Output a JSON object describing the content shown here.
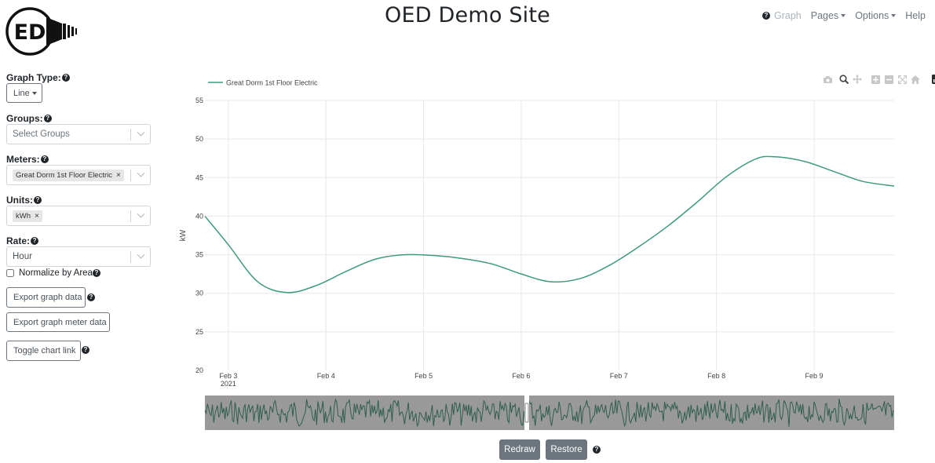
{
  "header": {
    "logo_text": "ED",
    "site_title": "OED Demo Site",
    "nav": {
      "graph_label": "Graph",
      "pages_label": "Pages",
      "options_label": "Options",
      "help_label": "Help"
    }
  },
  "sidebar": {
    "graph_type": {
      "label": "Graph Type:",
      "value": "Line"
    },
    "groups": {
      "label": "Groups:",
      "placeholder": "Select Groups"
    },
    "meters": {
      "label": "Meters:",
      "selected": [
        "Great Dorm 1st Floor Electric"
      ]
    },
    "units": {
      "label": "Units:",
      "selected": [
        "kWh"
      ]
    },
    "rate": {
      "label": "Rate:",
      "value": "Hour"
    },
    "normalize": {
      "label": "Normalize by Area",
      "checked": false
    },
    "export_graph_data_label": "Export graph data",
    "export_meter_data_label": "Export graph meter data",
    "toggle_chart_link_label": "Toggle chart link"
  },
  "controls": {
    "redraw_label": "Redraw",
    "restore_label": "Restore"
  },
  "icons": {
    "help": "question-circle-icon",
    "camera": "camera-icon",
    "zoom": "zoom-icon",
    "pan": "pan-icon",
    "zoom_in": "zoom-in-icon",
    "zoom_out": "zoom-out-icon",
    "autoscale": "autoscale-icon",
    "reset": "home-icon",
    "plotly": "plotly-logo-icon"
  },
  "colors": {
    "series": "#3f9b7b",
    "range_slider_bg": "#999999",
    "range_slider_line": "#2f5e4e",
    "button_dark": "#6c757d"
  },
  "chart_data": {
    "type": "line",
    "title": "",
    "xlabel": "",
    "ylabel": "kW",
    "ylim": [
      20,
      55
    ],
    "yticks": [
      20,
      25,
      30,
      35,
      40,
      45,
      50,
      55
    ],
    "x_ticks": [
      "Feb 3",
      "Feb 4",
      "Feb 5",
      "Feb 6",
      "Feb 7",
      "Feb 8",
      "Feb 9"
    ],
    "x_year_label": "2021",
    "grid": true,
    "legend_position": "top-left",
    "series": [
      {
        "name": "Great Dorm 1st Floor Electric",
        "x": [
          2.76,
          3.0,
          3.3,
          3.6,
          3.9,
          4.2,
          4.5,
          4.8,
          5.1,
          5.4,
          5.7,
          6.0,
          6.3,
          6.6,
          6.9,
          7.2,
          7.5,
          7.8,
          8.1,
          8.4,
          8.6,
          8.9,
          9.2,
          9.5,
          9.82
        ],
        "values": [
          40.0,
          36.3,
          31.5,
          30.1,
          31.0,
          32.8,
          34.4,
          35.0,
          34.9,
          34.5,
          33.8,
          32.5,
          31.5,
          31.9,
          33.6,
          36.0,
          38.7,
          41.8,
          45.1,
          47.4,
          47.7,
          47.1,
          45.8,
          44.5,
          43.9
        ]
      }
    ]
  }
}
